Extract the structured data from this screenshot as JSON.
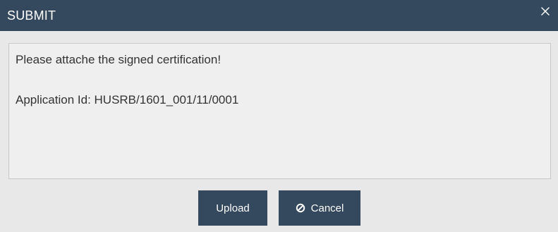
{
  "dialog": {
    "title": "SUBMIT",
    "close_icon": "close-icon",
    "message": "Please attache the signed certification!",
    "application_id_text": "Application Id: HUSRB/1601_001/11/0001",
    "buttons": {
      "upload_label": "Upload",
      "cancel_label": "Cancel",
      "cancel_icon": "ban-icon"
    }
  },
  "colors": {
    "header_bg": "#34495e",
    "button_bg": "#34495e",
    "body_bg": "#e8e8e8",
    "content_bg": "#efefef",
    "text": "#333333"
  }
}
